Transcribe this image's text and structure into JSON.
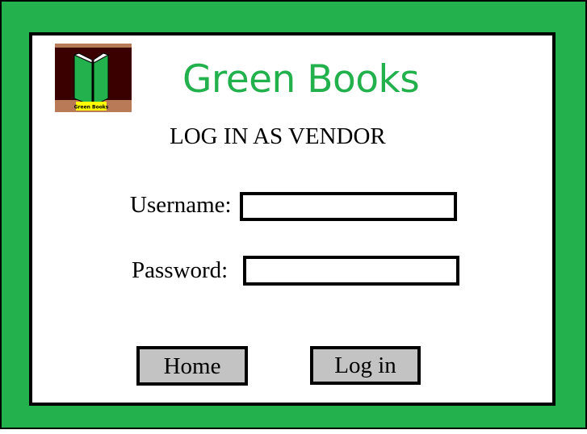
{
  "brand": {
    "name": "Green Books",
    "logo_caption": "Green Books",
    "color": "#22b14c"
  },
  "form": {
    "heading": "LOG IN AS VENDOR",
    "username_label": "Username:",
    "username_value": "",
    "password_label": "Password:",
    "password_value": ""
  },
  "buttons": {
    "home_label": "Home",
    "login_label": "Log in"
  },
  "colors": {
    "background_frame": "#22b14c",
    "panel": "#ffffff",
    "border": "#000000",
    "button_fill": "#c3c3c3",
    "logo_frame": "#b97a57",
    "logo_background": "#3a0000",
    "logo_book": "#22b14c",
    "logo_caption_bg": "#ffff00"
  }
}
